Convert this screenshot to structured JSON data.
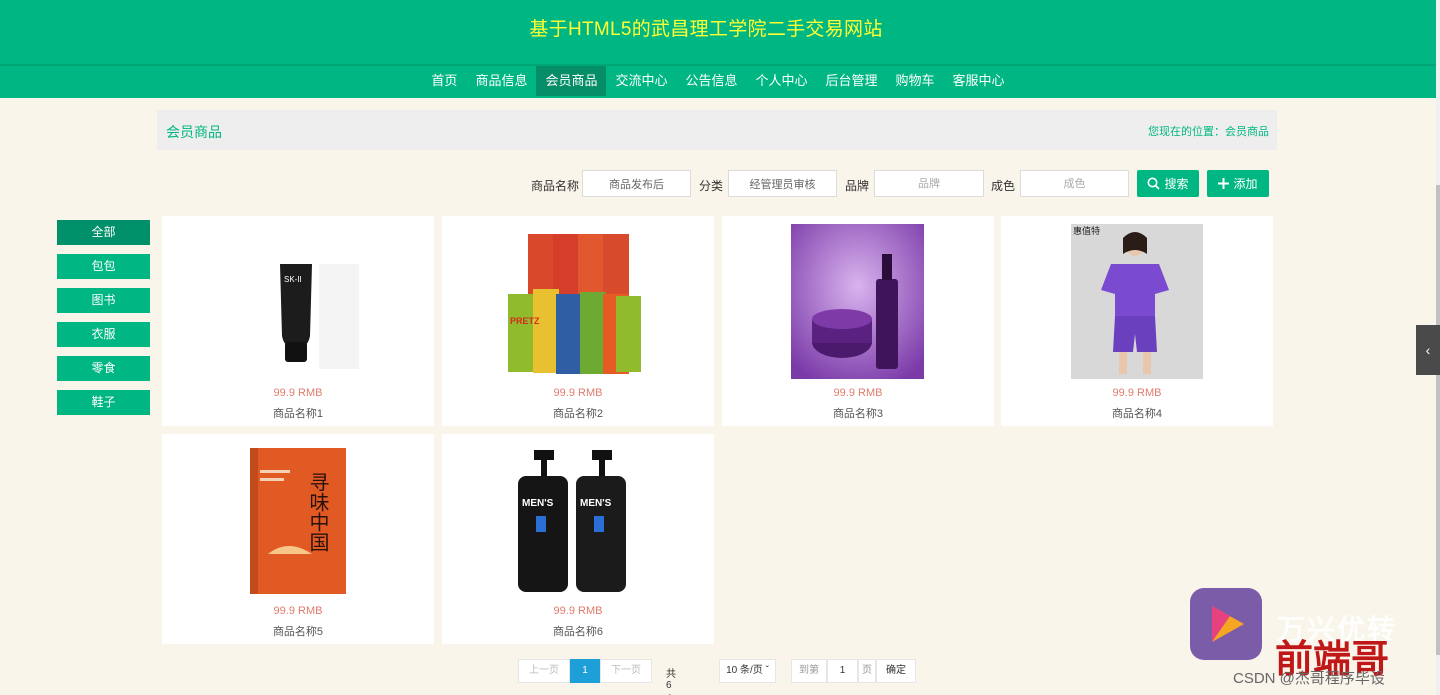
{
  "header": {
    "title": "基于HTML5的武昌理工学院二手交易网站",
    "nav": [
      {
        "label": "首页",
        "active": false
      },
      {
        "label": "商品信息",
        "active": false
      },
      {
        "label": "会员商品",
        "active": true
      },
      {
        "label": "交流中心",
        "active": false
      },
      {
        "label": "公告信息",
        "active": false
      },
      {
        "label": "个人中心",
        "active": false
      },
      {
        "label": "后台管理",
        "active": false
      },
      {
        "label": "购物车",
        "active": false
      },
      {
        "label": "客服中心",
        "active": false
      }
    ]
  },
  "breadcrumb": {
    "title": "会员商品",
    "location_prefix": "您现在的位置：",
    "location": "会员商品"
  },
  "search": {
    "name_label": "商品名称",
    "name_value": "商品发布后",
    "category_label": "分类",
    "category_value": "经管理员审核",
    "brand_label": "品牌",
    "brand_placeholder": "品牌",
    "condition_label": "成色",
    "condition_placeholder": "成色",
    "search_button": "搜索",
    "add_button": "添加"
  },
  "categories": [
    {
      "label": "全部",
      "active": true
    },
    {
      "label": "包包",
      "active": false
    },
    {
      "label": "图书",
      "active": false
    },
    {
      "label": "衣服",
      "active": false
    },
    {
      "label": "零食",
      "active": false
    },
    {
      "label": "鞋子",
      "active": false
    }
  ],
  "products": [
    {
      "price": "99.9 RMB",
      "name": "商品名称1",
      "image": "skincare-tube"
    },
    {
      "price": "99.9 RMB",
      "name": "商品名称2",
      "image": "snack-boxes",
      "image_text": "PRETZ"
    },
    {
      "price": "99.9 RMB",
      "name": "商品名称3",
      "image": "cosmetics-purple"
    },
    {
      "price": "99.9 RMB",
      "name": "商品名称4",
      "image": "purple-outfit",
      "image_text": "惠值特"
    },
    {
      "price": "99.9 RMB",
      "name": "商品名称5",
      "image": "book-cover",
      "image_text": "寻味中国"
    },
    {
      "price": "99.9 RMB",
      "name": "商品名称6",
      "image": "mens-cleanser",
      "image_text": "MEN'S"
    }
  ],
  "pagination": {
    "prev": "上一页",
    "current": "1",
    "next": "下一页",
    "total": "共 6 条",
    "page_size": "10 条/页",
    "goto_label": "到第",
    "goto_value": "1",
    "page_unit": "页",
    "confirm": "确定"
  },
  "overlay": {
    "watermark_brand": "万兴优转",
    "watermark_name": "前端哥",
    "watermark_credit": "CSDN @杰哥程序毕设"
  },
  "colors": {
    "primary": "#00b783",
    "title": "#ffff33",
    "price": "#e07b6c",
    "page_active": "#1e9fd8"
  }
}
